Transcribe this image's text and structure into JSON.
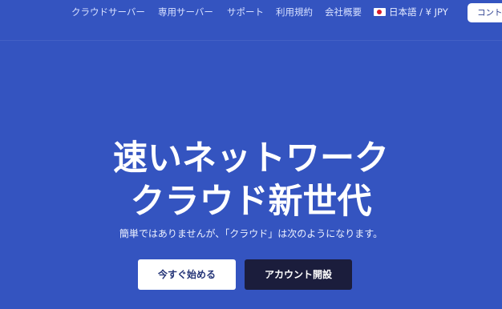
{
  "nav": {
    "links": [
      "クラウドサーバー",
      "専用サーバー",
      "サポート",
      "利用規約",
      "会社概要"
    ],
    "language": "日本語 / ¥ JPY",
    "contact_button": "コント"
  },
  "hero": {
    "title_line1": "速いネットワーク",
    "title_line2": "クラウド新世代",
    "subtitle": "簡単ではありませんが、「クラウド」は次のようになります。",
    "primary_button": "今すぐ始める",
    "secondary_button": "アカウント開設"
  },
  "colors": {
    "background": "#3454c0",
    "primary_button_bg": "#ffffff",
    "secondary_button_bg": "#1b1d3c",
    "flag_red": "#d71c2c"
  },
  "icons": {
    "language_flag": "japan-flag-icon"
  }
}
